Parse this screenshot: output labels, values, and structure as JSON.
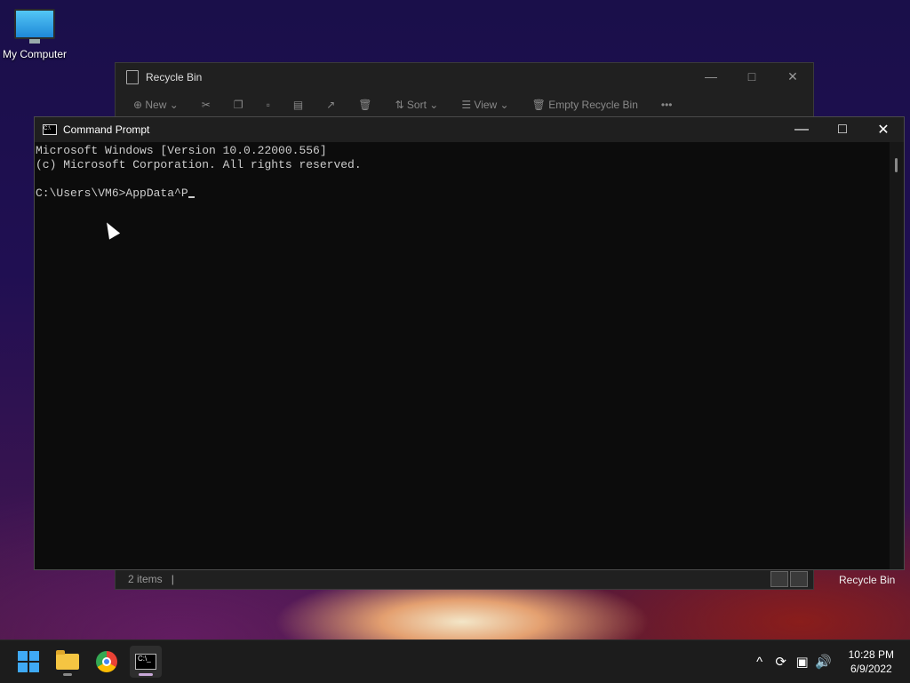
{
  "desktop": {
    "icons": [
      {
        "label": "My Computer"
      },
      {
        "label": "Recycle Bin"
      }
    ]
  },
  "recycle_bin_window": {
    "title": "Recycle Bin",
    "toolbar": {
      "new_label": "New",
      "sort_label": "Sort",
      "view_label": "View",
      "empty_label": "Empty Recycle Bin",
      "more_label": "•••"
    },
    "status": {
      "item_count": "2 items",
      "separator": "|"
    }
  },
  "cmd_window": {
    "title": "Command Prompt",
    "lines": [
      "Microsoft Windows [Version 10.0.22000.556]",
      "(c) Microsoft Corporation. All rights reserved.",
      "",
      "C:\\Users\\VM6>AppData^P"
    ]
  },
  "taskbar": {
    "apps": [
      {
        "name": "start",
        "icon": "windows-logo-icon"
      },
      {
        "name": "file-explorer",
        "icon": "folder-icon"
      },
      {
        "name": "chrome",
        "icon": "chrome-icon"
      },
      {
        "name": "command-prompt",
        "icon": "terminal-icon",
        "active": true
      }
    ],
    "tray": {
      "chevron": "^",
      "time": "10:28 PM",
      "date": "6/9/2022"
    }
  }
}
